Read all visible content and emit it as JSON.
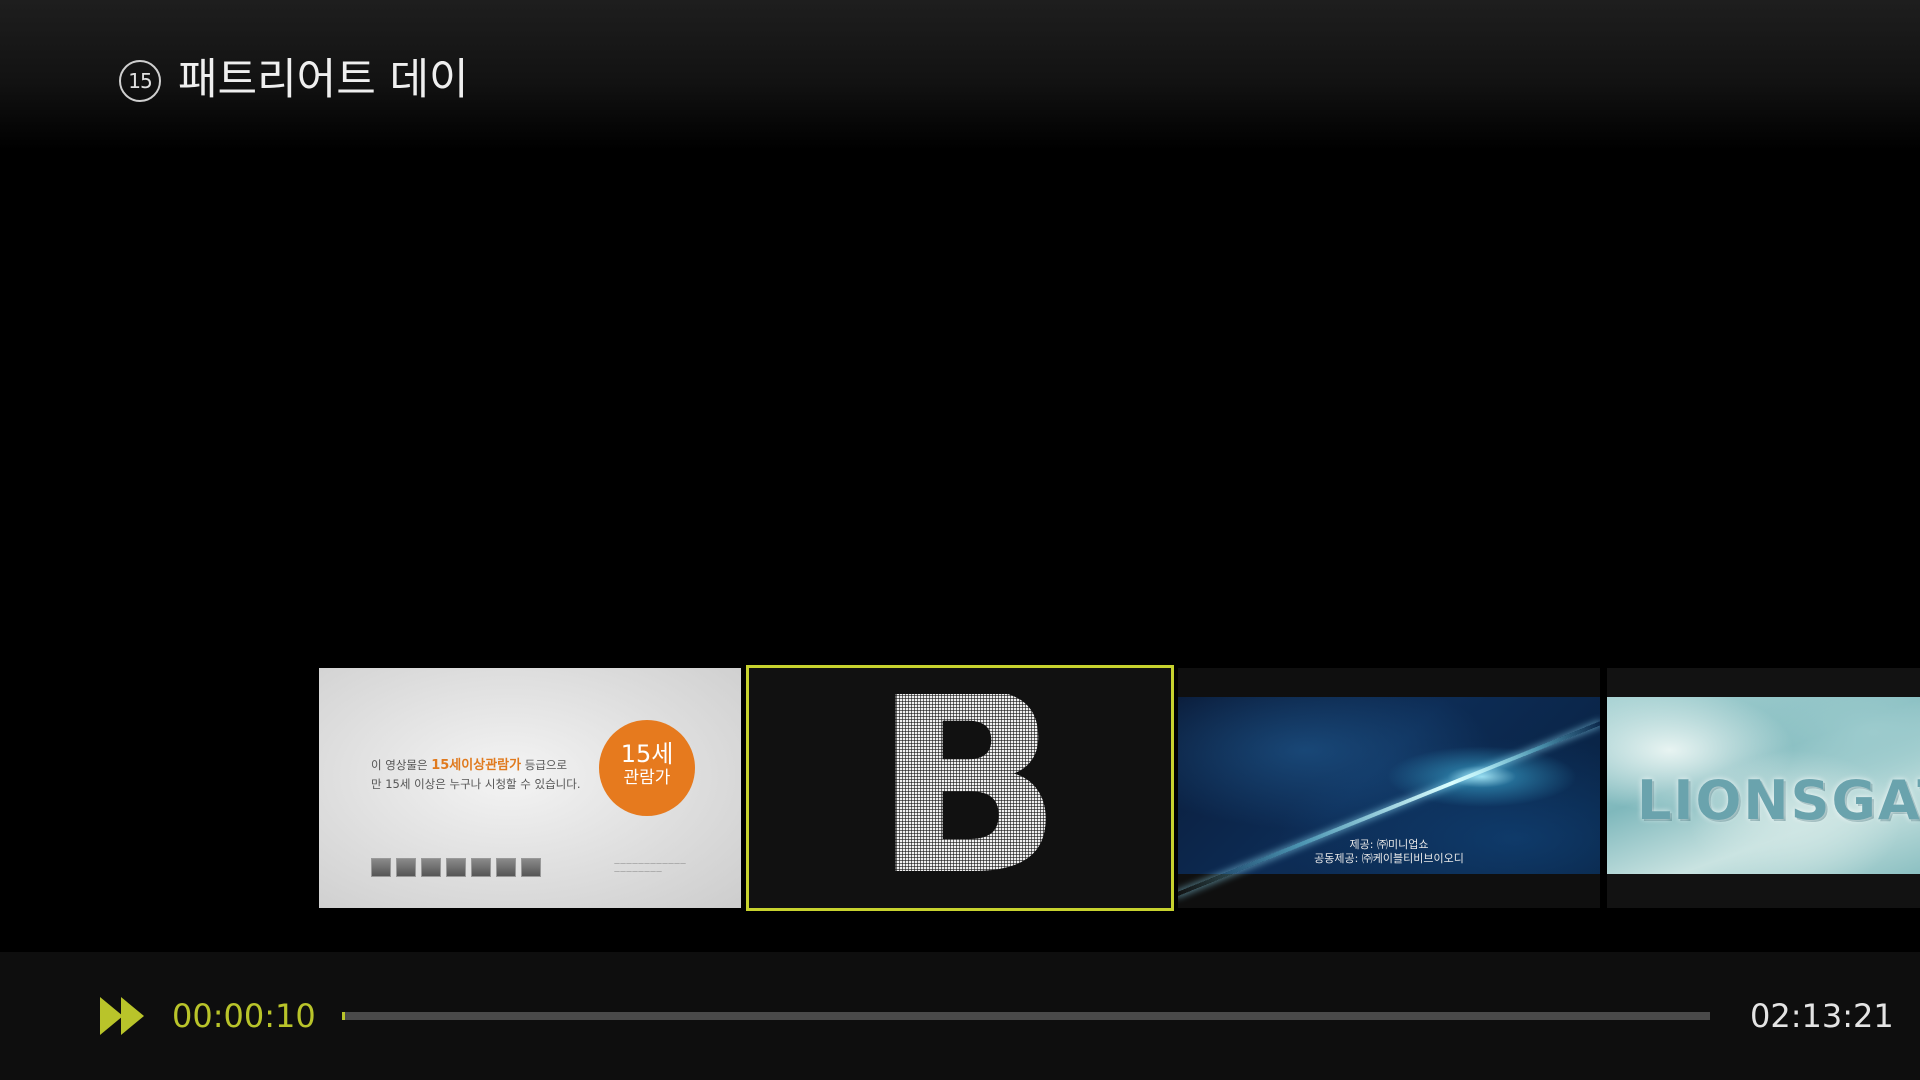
{
  "header": {
    "rating": "15",
    "title": "패트리어트 데이"
  },
  "thumbnails": [
    {
      "notice_prefix": "이 영상물은 ",
      "notice_highlight": "15세이상관람가",
      "notice_suffix": " 등급으로",
      "notice_line2": "만 15세 이상은 누구나 시청할 수 있습니다.",
      "age_big": "15세",
      "age_small": "관람가"
    },
    {
      "letter": "B",
      "selected": true
    },
    {
      "credit_line1": "제공: ㈜미니업쇼",
      "credit_line2": "공동제공: ㈜케이블티비브이오디"
    },
    {
      "brand": "LIONSGATE"
    }
  ],
  "player": {
    "current_time": "00:00:10",
    "total_time": "02:13:21",
    "progress_fraction": 0.0013,
    "accent_color": "#b9c42a",
    "mode_icon": "fast-forward-icon"
  }
}
